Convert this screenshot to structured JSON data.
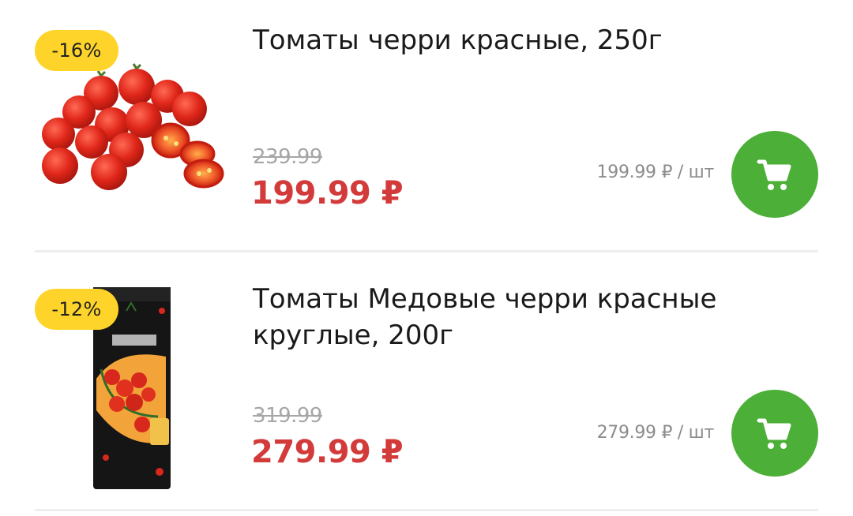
{
  "colors": {
    "badge": "#ffd42a",
    "price_red": "#d33a3a",
    "cart_green": "#4caf37",
    "muted_text": "#a6a6a6"
  },
  "products": [
    {
      "discount": "-16%",
      "title": "Томаты черри красные, 250г",
      "old_price": "239.99",
      "price": "199.99 ₽",
      "unit_price": "199.99 ₽ / шт",
      "image": "cherry-tomatoes-image",
      "cart_icon": "cart-icon"
    },
    {
      "discount": "-12%",
      "title": "Томаты Медовые черри красные круглые, 200г",
      "old_price": "319.99",
      "price": "279.99 ₽",
      "unit_price": "279.99 ₽ / шт",
      "image": "package-image",
      "cart_icon": "cart-icon"
    }
  ]
}
